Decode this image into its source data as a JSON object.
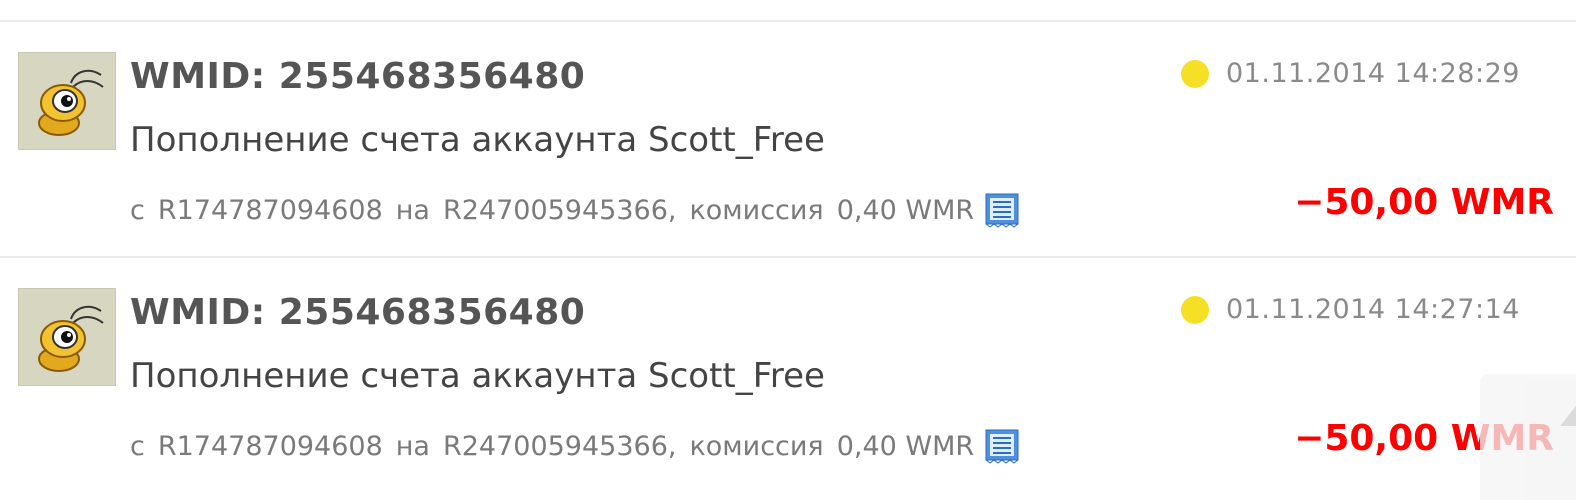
{
  "transactions": [
    {
      "wmid": "WMID: 255468356480",
      "description": "Пополнение счета аккаунта Scott_Free",
      "from_word": "с",
      "from_purse": "R174787094608",
      "to_word": "на",
      "to_purse": "R247005945366,",
      "commission_word": "комиссия",
      "commission": "0,40 WMR",
      "datetime": "01.11.2014 14:28:29",
      "amount": "−50,00 WMR",
      "status_color": "#f5e026"
    },
    {
      "wmid": "WMID: 255468356480",
      "description": "Пополнение счета аккаунта Scott_Free",
      "from_word": "с",
      "from_purse": "R174787094608",
      "to_word": "на",
      "to_purse": "R247005945366,",
      "commission_word": "комиссия",
      "commission": "0,40 WMR",
      "datetime": "01.11.2014 14:27:14",
      "amount": "−50,00 WMR",
      "status_color": "#f5e026"
    }
  ],
  "colors": {
    "amount_negative": "#ff0000",
    "avatar_bg": "#d7d6c0",
    "separator": "#ececec"
  },
  "icons": {
    "avatar": "ant-avatar-icon",
    "receipt": "receipt-icon",
    "status": "status-dot-icon",
    "scroll": "scroll-up-icon"
  }
}
